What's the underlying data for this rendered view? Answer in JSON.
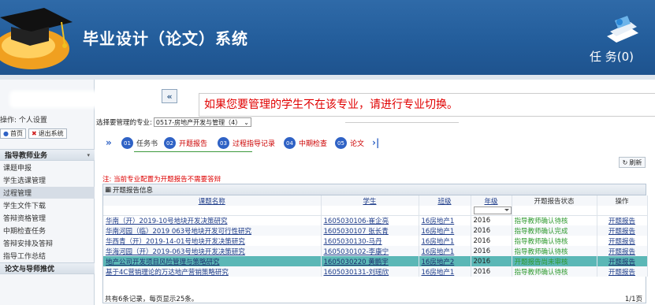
{
  "header": {
    "app_title": "毕业设计（论文）系统",
    "task_label": "任 务(0)"
  },
  "sidebar": {
    "user_line": "操作: 个人设置",
    "buttons": [
      {
        "label": "首页",
        "icon": "home-icon"
      },
      {
        "label": "退出系统",
        "icon": "close-icon"
      }
    ],
    "groups": [
      {
        "label": "指导教师业务",
        "items": [
          "课题申报",
          "学生选课管理",
          "过程管理",
          "学生文件下载",
          "答辩资格管理",
          "中期检查任务",
          "答辩安排及答辩",
          "指导工作总结"
        ]
      },
      {
        "label": "论文与导师推优",
        "items": []
      }
    ],
    "active_item": "过程管理"
  },
  "main": {
    "notice": "如果您要管理的学生不在该专业，请进行专业切换。",
    "major_label": "选择要管理的专业:",
    "major_value": "0517-房地产开发与管理（4）",
    "steps": [
      {
        "num": "01",
        "label": "任务书",
        "done": true
      },
      {
        "num": "02",
        "label": "开题报告",
        "done": false
      },
      {
        "num": "03",
        "label": "过程指导记录",
        "done": false
      },
      {
        "num": "04",
        "label": "中期检查",
        "done": false
      },
      {
        "num": "05",
        "label": "论文",
        "done": false
      }
    ],
    "refresh_label": "刷新",
    "hint": "注: 当前专业配置为开题报告不需要答辩",
    "panel_title": "开题报告信息",
    "columns": [
      "课题名称",
      "学生",
      "班级",
      "年级",
      "开题报告状态",
      "操作"
    ],
    "rows": [
      {
        "title": "华南（开）2019-10号地块开发决策研究",
        "student": "1605030106-崔企亮",
        "class": "16房地产1",
        "grade": "2016",
        "status": "指导教师确认待核",
        "action": "开题报告"
      },
      {
        "title": "华南河园（临）2019 063号地块开发可行性研究",
        "student": "1605030107 张长青",
        "class": "16房地产1",
        "grade": "2016",
        "status": "指导教师确认完成",
        "action": "开题报告"
      },
      {
        "title": "华西青（开）2019-14-01号地块开发决策研究",
        "student": "1605030130-马丹",
        "class": "16房地产1",
        "grade": "2016",
        "status": "指导教师确认待核",
        "action": "开题报告"
      },
      {
        "title": "华海河园（开）2019-063号地块开发决策研究",
        "student": "1605030102-李康宁",
        "class": "16房地产1",
        "grade": "2016",
        "status": "指导教师确认待核",
        "action": "开题报告"
      },
      {
        "title": "地产公司开发项目风险管理与策略研究",
        "student": "1605030220 黄鹏宇",
        "class": "16房地产2",
        "grade": "2016",
        "status": "开题报告尚未审核",
        "action": "开题报告"
      },
      {
        "title": "基于4C营销理论的万达地产营销策略研究",
        "student": "1605030131-刘瑶欣",
        "class": "16房地产1",
        "grade": "2016",
        "status": "指导教师确认待核",
        "action": "开题报告"
      }
    ],
    "selected_row": 4,
    "footer_left": "共有6条记录，每页显示25条。",
    "footer_right": "1/1页"
  }
}
